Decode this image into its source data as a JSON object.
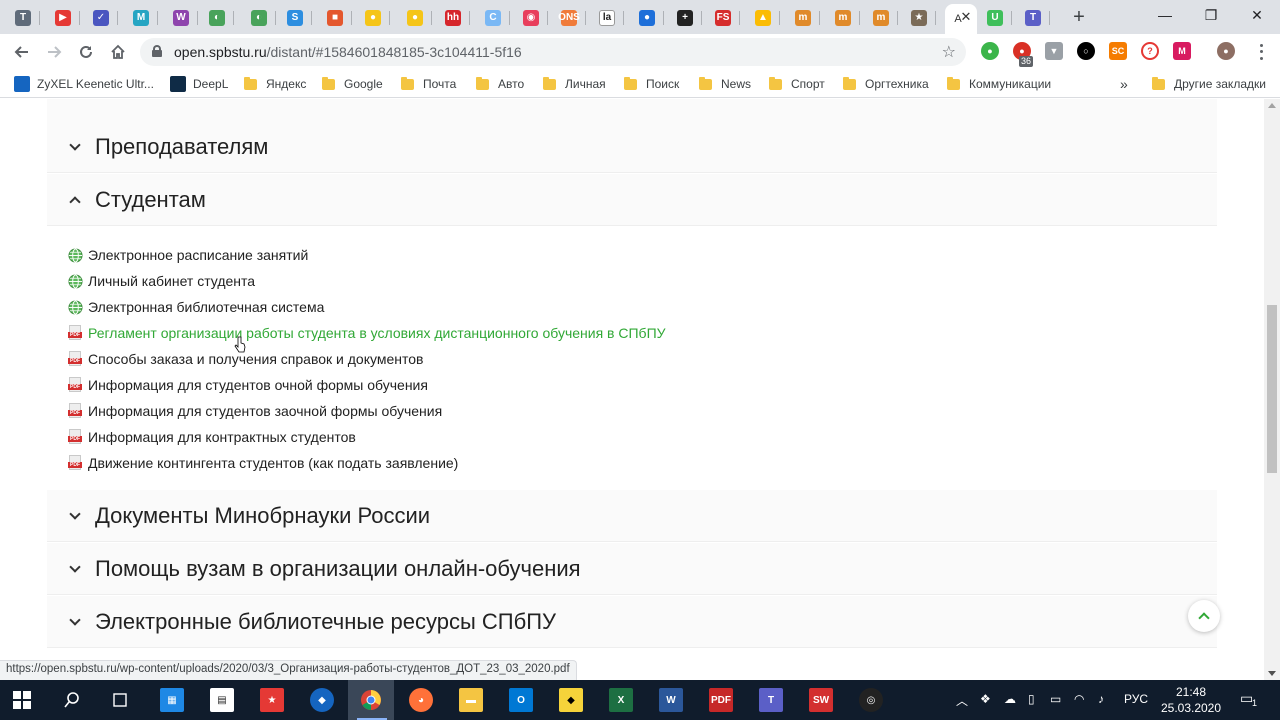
{
  "browser": {
    "tabs": [
      {
        "icon": "T",
        "color": "#5f6b7a"
      },
      {
        "icon": "▶",
        "color": "#e53935"
      },
      {
        "icon": "✓",
        "color": "#4a56c0"
      },
      {
        "icon": "M",
        "color": "#26a5c3"
      },
      {
        "icon": "W",
        "color": "#8e44ad"
      },
      {
        "icon": "◐",
        "color": "#49a35b"
      },
      {
        "icon": "◐",
        "color": "#49a35b"
      },
      {
        "icon": "S",
        "color": "#2d8ee0"
      },
      {
        "icon": "■",
        "color": "#e4572e"
      },
      {
        "icon": "●",
        "color": "#f5c518"
      },
      {
        "icon": "●",
        "color": "#f5c518"
      },
      {
        "icon": "hh",
        "color": "#d6262c"
      },
      {
        "icon": "C",
        "color": "#7ab8f5"
      },
      {
        "icon": "◉",
        "color": "#e83e5c"
      },
      {
        "icon": "ONS",
        "color": "#f07b3a"
      },
      {
        "icon": "la",
        "color": "#ffffff"
      },
      {
        "icon": "●",
        "color": "#1e6fd9"
      },
      {
        "icon": "+",
        "color": "#222222"
      },
      {
        "icon": "FS",
        "color": "#d62d2d"
      },
      {
        "icon": "▲",
        "color": "#fbbc04"
      },
      {
        "icon": "m",
        "color": "#e08a2a"
      },
      {
        "icon": "m",
        "color": "#e08a2a"
      },
      {
        "icon": "m",
        "color": "#e08a2a"
      },
      {
        "icon": "★",
        "color": "#7b6b58"
      }
    ],
    "active_tab_icon": "A",
    "more_tabs": [
      {
        "icon": "U",
        "color": "#3fbf5b"
      },
      {
        "icon": "T",
        "color": "#5b5fc7"
      }
    ],
    "url_host": "open.spbstu.ru",
    "url_rest": "/distant/#1584601848185-3c104411-5f16",
    "extension_badge": "36",
    "window_controls": {
      "minimize": "—",
      "restore": "❐",
      "close": "✕"
    }
  },
  "bookmarks": [
    {
      "label": "ZyXEL Keenetic Ultr...",
      "type": "site",
      "color": "#1565c0"
    },
    {
      "label": "DeepL",
      "type": "site",
      "color": "#0f2b46"
    },
    {
      "label": "Яндекс",
      "type": "folder"
    },
    {
      "label": "Google",
      "type": "folder"
    },
    {
      "label": "Почта",
      "type": "folder"
    },
    {
      "label": "Авто",
      "type": "folder"
    },
    {
      "label": "Личная",
      "type": "folder"
    },
    {
      "label": "Поиск",
      "type": "folder"
    },
    {
      "label": "News",
      "type": "folder"
    },
    {
      "label": "Спорт",
      "type": "folder"
    },
    {
      "label": "Оргтехника",
      "type": "folder"
    },
    {
      "label": "Коммуникации",
      "type": "folder"
    }
  ],
  "bookmarks_overflow": "»",
  "other_bookmarks": "Другие закладки",
  "page": {
    "sections": [
      {
        "title": "Преподавателям",
        "expanded": false
      },
      {
        "title": "Студентам",
        "expanded": true
      },
      {
        "title": "Документы Минобрнауки России",
        "expanded": false
      },
      {
        "title": "Помощь вузам в организации онлайн-обучения",
        "expanded": false
      },
      {
        "title": "Электронные библиотечные ресурсы СПбПУ",
        "expanded": false
      }
    ],
    "student_items": [
      {
        "label": "Электронное расписание занятий",
        "icon": "globe"
      },
      {
        "label": "Личный кабинет студента",
        "icon": "globe"
      },
      {
        "label": "Электронная библиотечная система",
        "icon": "globe"
      },
      {
        "label": "Регламент организации работы студента в условиях дистанционного обучения в СПбПУ",
        "icon": "pdf",
        "hovered": true
      },
      {
        "label": "Способы заказа и получения справок и документов",
        "icon": "pdf"
      },
      {
        "label": "Информация для студентов очной формы обучения",
        "icon": "pdf"
      },
      {
        "label": "Информация для студентов заочной формы обучения",
        "icon": "pdf"
      },
      {
        "label": "Информация для контрактных студентов",
        "icon": "pdf"
      },
      {
        "label": "Движение контингента студентов (как подать заявление)",
        "icon": "pdf"
      }
    ]
  },
  "status_url": "https://open.spbstu.ru/wp-content/uploads/2020/03/3_Организация-работы-студентов_ДОТ_23_03_2020.pdf",
  "taskbar": {
    "language": "РУС",
    "time": "21:48",
    "date": "25.03.2020",
    "notification_count": "1"
  },
  "colors": {
    "link_hover": "#31a836",
    "tabstrip_bg": "#dee1e6",
    "taskbar_bg": "#101c2c"
  }
}
